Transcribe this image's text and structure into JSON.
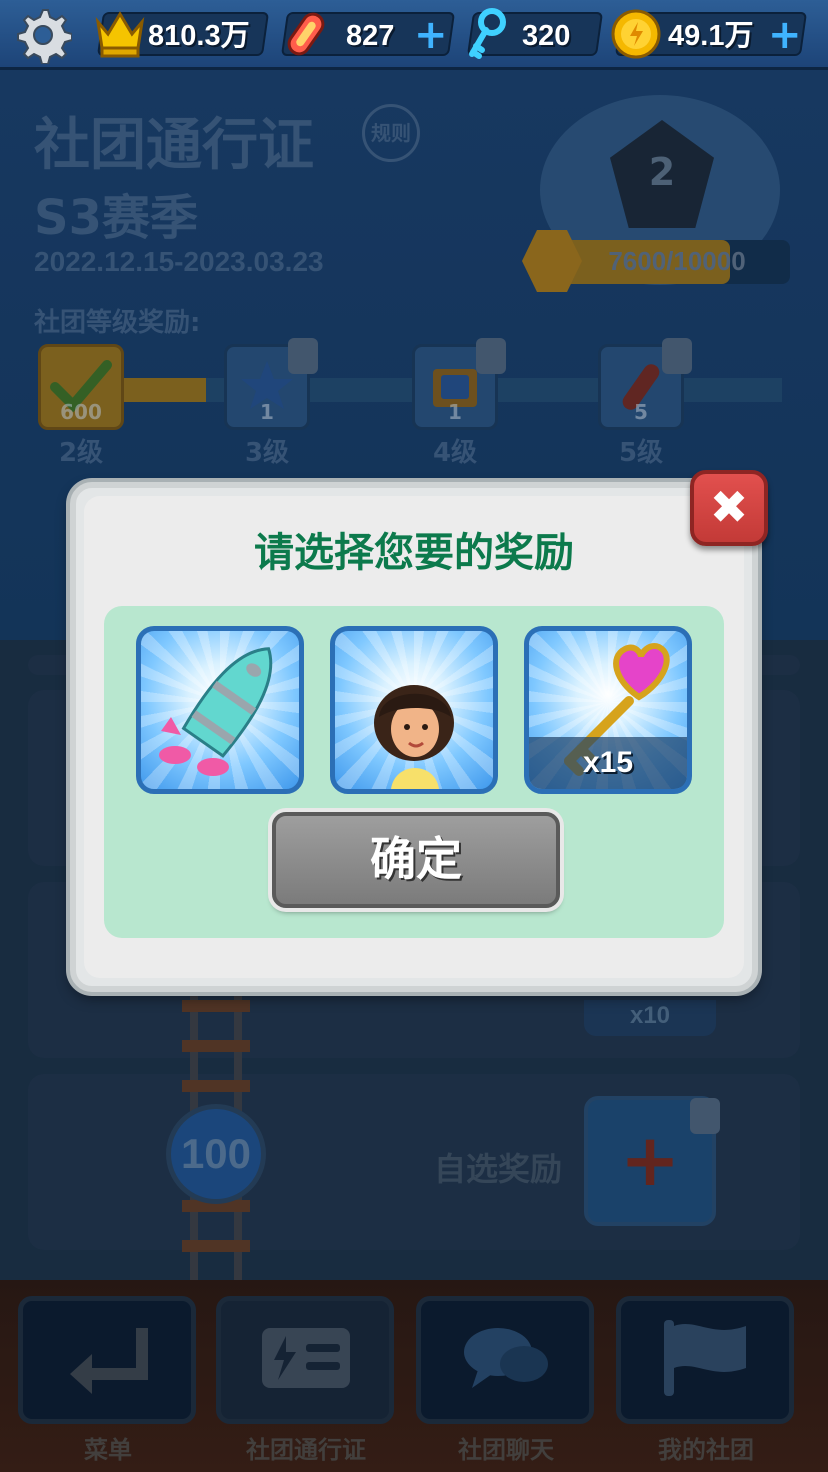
{
  "topbar": {
    "crown_value": "810.3万",
    "board_value": "827",
    "key_value": "320",
    "coin_value": "49.1万"
  },
  "background": {
    "title": "社团通行证",
    "rules_label": "规则",
    "season": "S3赛季",
    "dates": "2022.12.15-2023.03.23",
    "level_rewards_title": "社团等级奖励:",
    "badge_level": "2",
    "xp_text": "7600/10000",
    "xp_progress": 0.76,
    "levels": [
      {
        "label": "2级",
        "amount": "600",
        "claimed": true
      },
      {
        "label": "3级",
        "amount": "1",
        "claimed": false
      },
      {
        "label": "4级",
        "amount": "1",
        "claimed": false
      },
      {
        "label": "5级",
        "amount": "5",
        "claimed": false
      }
    ],
    "node_value": "100",
    "self_select_label": "自选奖励",
    "x10_label": "x10"
  },
  "modal": {
    "title": "请选择您要的奖励",
    "confirm_label": "确定",
    "key_count": "x15"
  },
  "nav": {
    "items": [
      {
        "label": "菜单"
      },
      {
        "label": "社团通行证"
      },
      {
        "label": "社团聊天"
      },
      {
        "label": "我的社团"
      }
    ]
  },
  "colors": {
    "title_green": "#0c7a4c",
    "close_red": "#d0403d",
    "panel_green": "#b8e7cf"
  }
}
